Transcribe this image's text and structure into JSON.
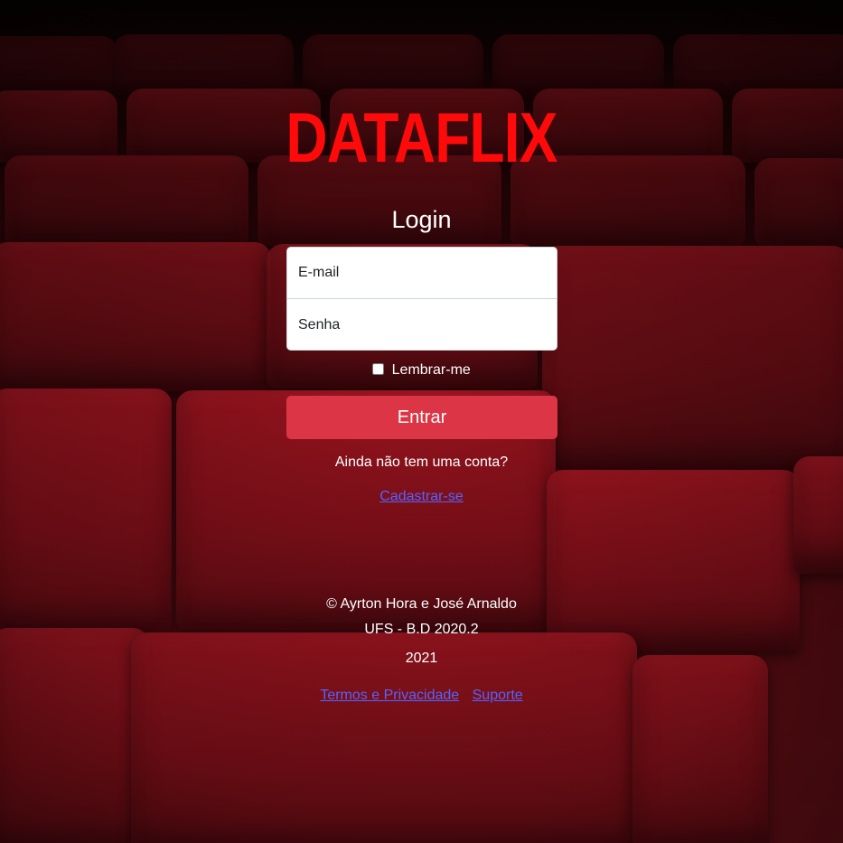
{
  "brand": {
    "logo_text": "DATAFLIX",
    "logo_color": "#ff0a0a"
  },
  "login": {
    "title": "Login",
    "email_placeholder": "E-mail",
    "password_placeholder": "Senha",
    "remember_label": "Lembrar-me",
    "remember_checked": false,
    "submit_label": "Entrar",
    "no_account_text": "Ainda não tem uma conta?",
    "signup_link": "Cadastrar-se"
  },
  "footer": {
    "credits": "© Ayrton Hora e José Arnaldo",
    "course": "UFS - B.D 2020.2",
    "year": "2021",
    "links": [
      "Termos e Privacidade",
      "Suporte"
    ]
  },
  "colors": {
    "accent": "#dc3545",
    "link": "#5563ff",
    "background": "#3b080b"
  }
}
